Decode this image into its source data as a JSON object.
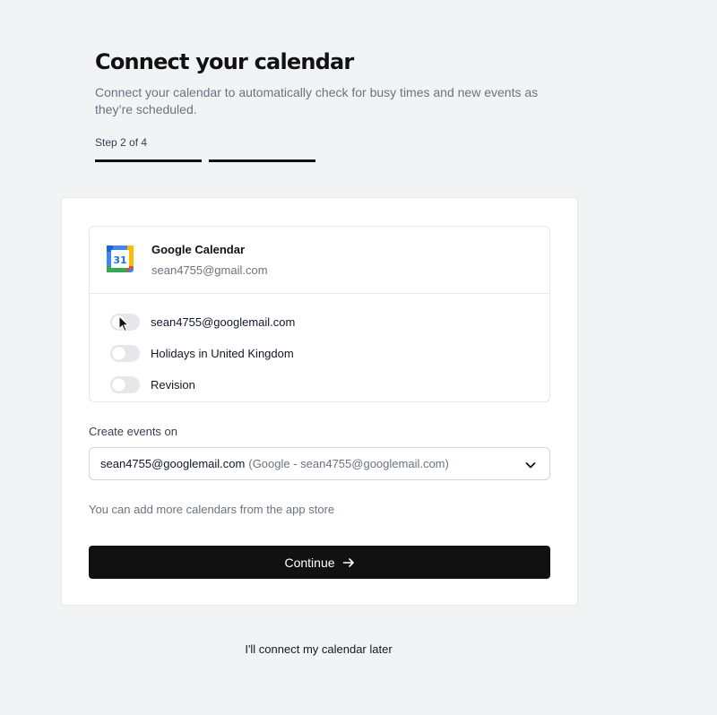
{
  "header": {
    "title": "Connect your calendar",
    "subtitle": "Connect your calendar to automatically check for busy times and new events as they’re scheduled.",
    "step": "Step 2 of 4"
  },
  "calendar": {
    "provider_name": "Google Calendar",
    "account_email": "sean4755@gmail.com",
    "icon": "google-calendar-icon",
    "icon_number": "31",
    "items": [
      {
        "label": "sean4755@googlemail.com",
        "enabled": false
      },
      {
        "label": "Holidays in United Kingdom",
        "enabled": false
      },
      {
        "label": "Revision",
        "enabled": false
      }
    ]
  },
  "create_events": {
    "label": "Create events on",
    "selected_main": "sean4755@googlemail.com",
    "selected_sub": "(Google - sean4755@googlemail.com)"
  },
  "hint": "You can add more calendars from the app store",
  "actions": {
    "continue_label": "Continue",
    "later_label": "I'll connect my calendar later"
  },
  "colors": {
    "background": "#f2f3f5",
    "primary_button": "#111111",
    "toggle_off": "#e5e7eb"
  }
}
